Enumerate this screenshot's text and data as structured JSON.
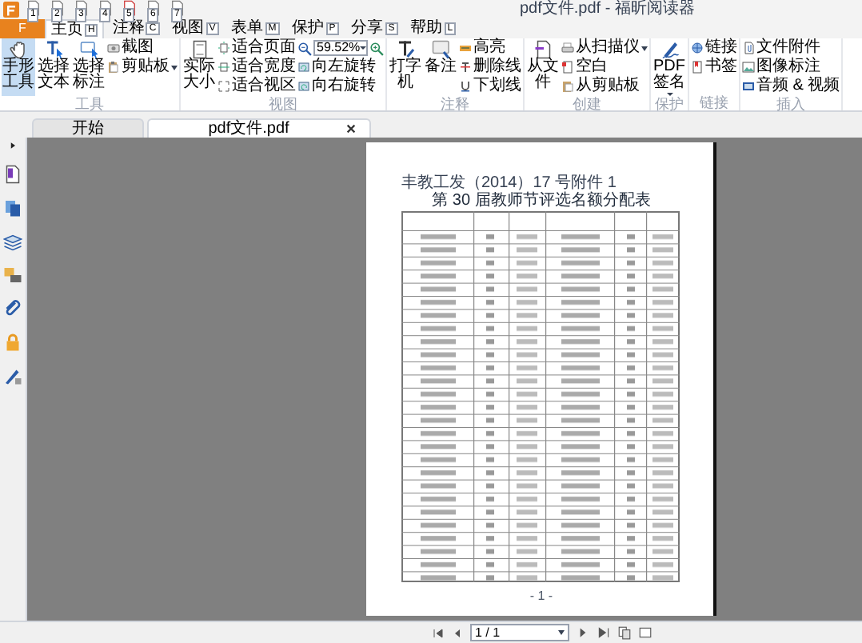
{
  "window": {
    "title": "pdf文件.pdf - 福昕阅读器"
  },
  "quick_access": [
    {
      "keytip": "1"
    },
    {
      "keytip": "2"
    },
    {
      "keytip": "3"
    },
    {
      "keytip": "4"
    },
    {
      "keytip": "5"
    },
    {
      "keytip": "6"
    },
    {
      "keytip": "7"
    }
  ],
  "file_tab": {
    "keytip": "F"
  },
  "tabs": [
    {
      "label": "主页",
      "keytip": "H",
      "selected": true
    },
    {
      "label": "注释",
      "keytip": "C",
      "selected": false
    },
    {
      "label": "视图",
      "keytip": "V",
      "selected": false
    },
    {
      "label": "表单",
      "keytip": "M",
      "selected": false
    },
    {
      "label": "保护",
      "keytip": "P",
      "selected": false
    },
    {
      "label": "分享",
      "keytip": "S",
      "selected": false
    },
    {
      "label": "帮助",
      "keytip": "L",
      "selected": false
    }
  ],
  "ribbon": [
    {
      "label": "工具",
      "columns": [
        [
          {
            "kind": "large",
            "label": "手形工具",
            "selected": true
          }
        ],
        [
          {
            "kind": "large",
            "label": "选择文本",
            "selected": false
          }
        ],
        [
          {
            "kind": "large",
            "label": "选择标注",
            "selected": false
          }
        ],
        [
          {
            "kind": "small",
            "label": "截图"
          },
          {
            "kind": "small",
            "label": "剪贴板",
            "dropdown": true
          }
        ]
      ]
    },
    {
      "label": "视图",
      "columns": [
        [
          {
            "kind": "large",
            "label": "实际大小"
          }
        ],
        [
          {
            "kind": "small",
            "label": "适合页面"
          },
          {
            "kind": "small",
            "label": "适合宽度"
          },
          {
            "kind": "small",
            "label": "适合视区"
          }
        ],
        [
          {
            "kind": "zoom",
            "value": "59.52%",
            "dropdown": true
          },
          {
            "kind": "small",
            "label": "向左旋转"
          },
          {
            "kind": "small",
            "label": "向右旋转"
          }
        ]
      ]
    },
    {
      "label": "注释",
      "columns": [
        [
          {
            "kind": "large",
            "label": "打字机"
          }
        ],
        [
          {
            "kind": "large",
            "label": "备注"
          }
        ],
        [
          {
            "kind": "small",
            "label": "高亮"
          },
          {
            "kind": "small",
            "label": "删除线"
          },
          {
            "kind": "small",
            "label": "下划线"
          }
        ]
      ]
    },
    {
      "label": "创建",
      "columns": [
        [
          {
            "kind": "large",
            "label": "从文件"
          }
        ],
        [
          {
            "kind": "small",
            "label": "从扫描仪",
            "dropdown": true
          },
          {
            "kind": "small",
            "label": "空白"
          },
          {
            "kind": "small",
            "label": "从剪贴板"
          }
        ]
      ]
    },
    {
      "label": "保护",
      "columns": [
        [
          {
            "kind": "large",
            "label": "PDF签名",
            "dropdown": true
          }
        ]
      ]
    },
    {
      "label": "链接",
      "columns": [
        [
          {
            "kind": "small",
            "label": "链接"
          },
          {
            "kind": "small",
            "label": "书签"
          }
        ]
      ]
    },
    {
      "label": "插入",
      "columns": [
        [
          {
            "kind": "small",
            "label": "文件附件"
          },
          {
            "kind": "small",
            "label": "图像标注"
          },
          {
            "kind": "small",
            "label": "音频 & 视频"
          }
        ]
      ]
    }
  ],
  "document_tabs": [
    {
      "label": "开始",
      "selected": false,
      "closable": false
    },
    {
      "label": "pdf文件.pdf",
      "selected": true,
      "closable": true
    }
  ],
  "document": {
    "heading": "丰教工发（2014）17 号附件 1",
    "title": "第 30 届教师节评选名额分配表",
    "page_number": "- 1 -"
  },
  "status_bar": {
    "page_field": "1 / 1"
  }
}
